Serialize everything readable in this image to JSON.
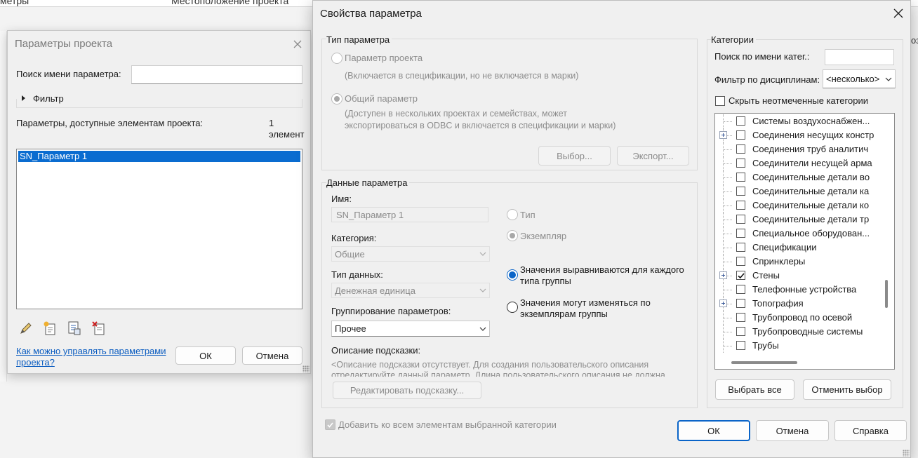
{
  "background": {
    "header_col1": "метры",
    "header_col2": "Местоположение проекта",
    "right_tab": "оз"
  },
  "project_params": {
    "title": "Параметры проекта",
    "search_label": "Поиск имени параметра:",
    "search_value": "",
    "filter_label": "Фильтр",
    "available_label": "Параметры, доступные элементам проекта:",
    "count_num": "1",
    "count_unit": "элемент",
    "params": [
      "SN_Параметр 1"
    ],
    "help_link": "Как можно управлять параметрами проекта?",
    "ok": "ОК",
    "cancel": "Отмена",
    "icons": [
      "edit-icon",
      "new-parameter-icon",
      "properties-icon",
      "delete-icon"
    ]
  },
  "param_props": {
    "title": "Свойства параметра",
    "type_group": {
      "label": "Тип параметра",
      "project_label": "Параметр проекта",
      "project_desc": "(Включается в спецификации, но не включается в марки)",
      "shared_label": "Общий параметр",
      "shared_desc_1": "(Доступен в нескольких проектах и семействах, может",
      "shared_desc_2": "экспортироваться в ODBC и включается в спецификации и марки)",
      "select_btn": "Выбор...",
      "export_btn": "Экспорт..."
    },
    "data_group": {
      "label": "Данные параметра",
      "name_label": "Имя:",
      "name_value": "SN_Параметр 1",
      "type_radio": "Тип",
      "instance_radio": "Экземпляр",
      "category_label": "Категория:",
      "category_value": "Общие",
      "datatype_label": "Тип данных:",
      "datatype_value": "Денежная единица",
      "align_radio": "Значения выравниваются для каждого типа группы",
      "vary_radio": "Значения могут изменяться по экземплярам группы",
      "grouping_label": "Группирование параметров:",
      "grouping_value": "Прочее",
      "tooltip_label": "Описание подсказки:",
      "tooltip_text": "<Описание подсказки отсутствует. Для создания пользовательского описания отредактируйте данный параметр. Длина пользовательского описания не должна",
      "edit_tooltip_btn": "Редактировать подсказку..."
    },
    "add_all_label": "Добавить ко всем элементам выбранной категории",
    "categories": {
      "label": "Категории",
      "search_label": "Поиск по имени катег.:",
      "search_value": "",
      "discipline_label": "Фильтр по дисциплинам:",
      "discipline_value": "<несколько>",
      "hide_unchecked": "Скрыть неотмеченные категории",
      "items": [
        {
          "label": "Системы воздухоснабжен...",
          "checked": false,
          "expandable": false
        },
        {
          "label": "Соединения несущих констр",
          "checked": false,
          "expandable": true
        },
        {
          "label": "Соединения труб аналитич",
          "checked": false,
          "expandable": false
        },
        {
          "label": "Соединители несущей арма",
          "checked": false,
          "expandable": false
        },
        {
          "label": "Соединительные детали во",
          "checked": false,
          "expandable": false
        },
        {
          "label": "Соединительные детали ка",
          "checked": false,
          "expandable": false
        },
        {
          "label": "Соединительные детали ко",
          "checked": false,
          "expandable": false
        },
        {
          "label": "Соединительные детали тр",
          "checked": false,
          "expandable": false
        },
        {
          "label": "Специальное оборудован...",
          "checked": false,
          "expandable": false
        },
        {
          "label": "Спецификации",
          "checked": false,
          "expandable": false
        },
        {
          "label": "Спринклеры",
          "checked": false,
          "expandable": false
        },
        {
          "label": "Стены",
          "checked": true,
          "expandable": true
        },
        {
          "label": "Телефонные устройства",
          "checked": false,
          "expandable": false
        },
        {
          "label": "Топография",
          "checked": false,
          "expandable": true
        },
        {
          "label": "Трубопровод по осевой",
          "checked": false,
          "expandable": false
        },
        {
          "label": "Трубопроводные системы",
          "checked": false,
          "expandable": false
        },
        {
          "label": "Трубы",
          "checked": false,
          "expandable": false
        }
      ],
      "select_all": "Выбрать все",
      "deselect_all": "Отменить выбор"
    },
    "ok": "ОК",
    "cancel": "Отмена",
    "help": "Справка"
  },
  "colors": {
    "accent": "#0a64c8",
    "selection": "#0a6cd0",
    "link": "#0a5cc0"
  }
}
